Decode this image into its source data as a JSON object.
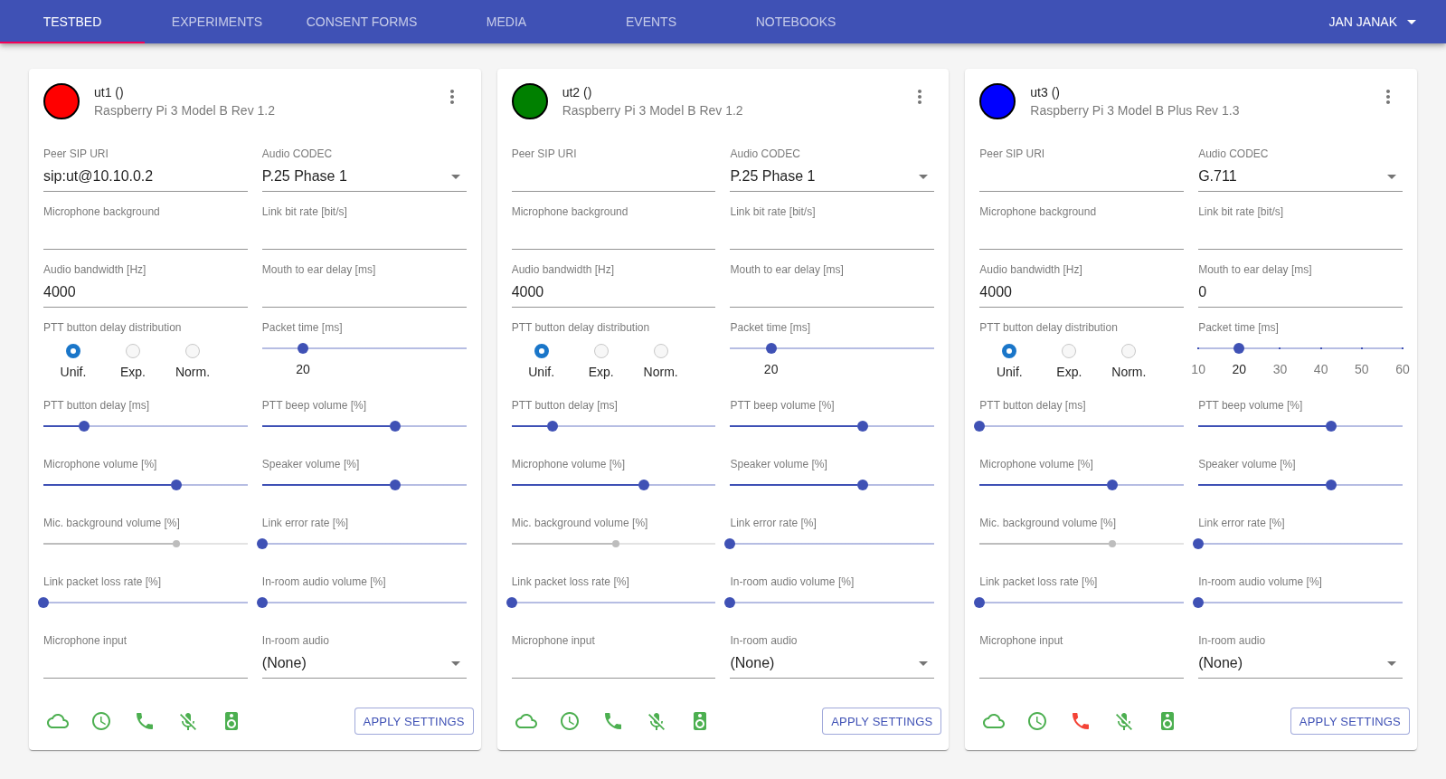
{
  "nav": {
    "tabs": [
      {
        "label": "TESTBED",
        "selected": true
      },
      {
        "label": "EXPERIMENTS",
        "selected": false
      },
      {
        "label": "CONSENT FORMS",
        "selected": false
      },
      {
        "label": "MEDIA",
        "selected": false
      },
      {
        "label": "EVENTS",
        "selected": false
      },
      {
        "label": "NOTEBOOKS",
        "selected": false
      }
    ],
    "user_menu": {
      "label": "JAN JANAK"
    }
  },
  "devices": [
    {
      "name": "ut1 ()",
      "model": "Raspberry Pi 3 Model B Rev 1.2",
      "color": "#ff0000",
      "fields": [
        {
          "kind": "text",
          "label": "Peer SIP URI",
          "value": "sip:ut@10.10.0.2"
        },
        {
          "kind": "select",
          "label": "Audio CODEC",
          "value": "P.25 Phase 1"
        },
        {
          "kind": "text",
          "label": "Microphone background"
        },
        {
          "kind": "text",
          "label": "Link bit rate [bit/s]"
        },
        {
          "kind": "text",
          "label": "Audio bandwidth [Hz]",
          "value": "4000"
        },
        {
          "kind": "text",
          "label": "Mouth to ear delay [ms]"
        },
        {
          "kind": "radio",
          "label": "PTT button delay distribution",
          "options": [
            {
              "label": "Unif.",
              "selected": true
            },
            {
              "label": "Exp.",
              "selected": false
            },
            {
              "label": "Norm.",
              "selected": false
            }
          ]
        },
        {
          "kind": "stepped_slider",
          "label": "Packet time [ms]",
          "level": 0.2,
          "marks": [
            {
              "label": "20",
              "selected": true
            }
          ]
        },
        {
          "kind": "slider",
          "label": "PTT button delay [ms]",
          "level": 0.2,
          "disabled": false
        },
        {
          "kind": "slider",
          "label": "PTT beep volume [%]",
          "level": 0.65,
          "disabled": false
        },
        {
          "kind": "slider",
          "label": "Microphone volume [%]",
          "level": 0.65,
          "disabled": false
        },
        {
          "kind": "slider",
          "label": "Speaker volume [%]",
          "level": 0.65,
          "disabled": false
        },
        {
          "kind": "slider",
          "label": "Mic. background volume [%]",
          "level": 0.65,
          "disabled": true
        },
        {
          "kind": "slider",
          "label": "Link error rate [%]",
          "level": 0,
          "disabled": false
        },
        {
          "kind": "slider",
          "label": "Link packet loss rate [%]",
          "level": 0,
          "disabled": false
        },
        {
          "kind": "slider",
          "label": "In-room audio volume [%]",
          "level": 0,
          "disabled": false
        },
        {
          "kind": "text",
          "label": "Microphone input"
        },
        {
          "kind": "select",
          "label": "In-room audio",
          "value": "(None)"
        }
      ],
      "status_icons": [
        {
          "kind": "cloud",
          "color": "#4caf50"
        },
        {
          "kind": "clock",
          "color": "#4caf50"
        },
        {
          "kind": "phone",
          "color": "#4caf50"
        },
        {
          "kind": "mic_off",
          "color": "#4caf50"
        },
        {
          "kind": "speaker",
          "color": "#4caf50"
        }
      ],
      "apply_button": "APPLY SETTINGS"
    },
    {
      "name": "ut2 ()",
      "model": "Raspberry Pi 3 Model B Rev 1.2",
      "color": "#008000",
      "fields": [
        {
          "kind": "text",
          "label": "Peer SIP URI"
        },
        {
          "kind": "select",
          "label": "Audio CODEC",
          "value": "P.25 Phase 1"
        },
        {
          "kind": "text",
          "label": "Microphone background"
        },
        {
          "kind": "text",
          "label": "Link bit rate [bit/s]"
        },
        {
          "kind": "text",
          "label": "Audio bandwidth [Hz]",
          "value": "4000"
        },
        {
          "kind": "text",
          "label": "Mouth to ear delay [ms]"
        },
        {
          "kind": "radio",
          "label": "PTT button delay distribution",
          "options": [
            {
              "label": "Unif.",
              "selected": true
            },
            {
              "label": "Exp.",
              "selected": false
            },
            {
              "label": "Norm.",
              "selected": false
            }
          ]
        },
        {
          "kind": "stepped_slider",
          "label": "Packet time [ms]",
          "level": 0.2,
          "marks": [
            {
              "label": "20",
              "selected": true
            }
          ]
        },
        {
          "kind": "slider",
          "label": "PTT button delay [ms]",
          "level": 0.2,
          "disabled": false
        },
        {
          "kind": "slider",
          "label": "PTT beep volume [%]",
          "level": 0.65,
          "disabled": false
        },
        {
          "kind": "slider",
          "label": "Microphone volume [%]",
          "level": 0.65,
          "disabled": false
        },
        {
          "kind": "slider",
          "label": "Speaker volume [%]",
          "level": 0.65,
          "disabled": false
        },
        {
          "kind": "slider",
          "label": "Mic. background volume [%]",
          "level": 0.51,
          "disabled": true
        },
        {
          "kind": "slider",
          "label": "Link error rate [%]",
          "level": 0,
          "disabled": false
        },
        {
          "kind": "slider",
          "label": "Link packet loss rate [%]",
          "level": 0,
          "disabled": false
        },
        {
          "kind": "slider",
          "label": "In-room audio volume [%]",
          "level": 0,
          "disabled": false
        },
        {
          "kind": "text",
          "label": "Microphone input"
        },
        {
          "kind": "select",
          "label": "In-room audio",
          "value": "(None)"
        }
      ],
      "status_icons": [
        {
          "kind": "cloud",
          "color": "#4caf50"
        },
        {
          "kind": "clock",
          "color": "#4caf50"
        },
        {
          "kind": "phone",
          "color": "#4caf50"
        },
        {
          "kind": "mic_off",
          "color": "#4caf50"
        },
        {
          "kind": "speaker",
          "color": "#4caf50"
        }
      ],
      "apply_button": "APPLY SETTINGS"
    },
    {
      "name": "ut3 ()",
      "model": "Raspberry Pi 3 Model B Plus Rev 1.3",
      "color": "#0000ff",
      "fields": [
        {
          "kind": "text",
          "label": "Peer SIP URI"
        },
        {
          "kind": "select",
          "label": "Audio CODEC",
          "value": "G.711"
        },
        {
          "kind": "text",
          "label": "Microphone background"
        },
        {
          "kind": "text",
          "label": "Link bit rate [bit/s]"
        },
        {
          "kind": "text",
          "label": "Audio bandwidth [Hz]",
          "value": "4000"
        },
        {
          "kind": "text",
          "label": "Mouth to ear delay [ms]",
          "value": "0"
        },
        {
          "kind": "radio",
          "label": "PTT button delay distribution",
          "options": [
            {
              "label": "Unif.",
              "selected": true
            },
            {
              "label": "Exp.",
              "selected": false
            },
            {
              "label": "Norm.",
              "selected": false
            }
          ]
        },
        {
          "kind": "stepped_slider",
          "label": "Packet time [ms]",
          "level": 0.2,
          "marks": [
            {
              "label": "10",
              "selected": false
            },
            {
              "label": "20",
              "selected": true
            },
            {
              "label": "30",
              "selected": false
            },
            {
              "label": "40",
              "selected": false
            },
            {
              "label": "50",
              "selected": false
            },
            {
              "label": "60",
              "selected": false
            }
          ]
        },
        {
          "kind": "slider",
          "label": "PTT button delay [ms]",
          "level": 0,
          "disabled": false
        },
        {
          "kind": "slider",
          "label": "PTT beep volume [%]",
          "level": 0.65,
          "disabled": false
        },
        {
          "kind": "slider",
          "label": "Microphone volume [%]",
          "level": 0.65,
          "disabled": false
        },
        {
          "kind": "slider",
          "label": "Speaker volume [%]",
          "level": 0.65,
          "disabled": false
        },
        {
          "kind": "slider",
          "label": "Mic. background volume [%]",
          "level": 0.65,
          "disabled": true
        },
        {
          "kind": "slider",
          "label": "Link error rate [%]",
          "level": 0,
          "disabled": false
        },
        {
          "kind": "slider",
          "label": "Link packet loss rate [%]",
          "level": 0,
          "disabled": false
        },
        {
          "kind": "slider",
          "label": "In-room audio volume [%]",
          "level": 0,
          "disabled": false
        },
        {
          "kind": "text",
          "label": "Microphone input"
        },
        {
          "kind": "select",
          "label": "In-room audio",
          "value": "(None)"
        }
      ],
      "status_icons": [
        {
          "kind": "cloud",
          "color": "#4caf50"
        },
        {
          "kind": "clock",
          "color": "#4caf50"
        },
        {
          "kind": "phone",
          "color": "#f44336"
        },
        {
          "kind": "mic_off",
          "color": "#4caf50"
        },
        {
          "kind": "speaker",
          "color": "#4caf50"
        }
      ],
      "apply_button": "APPLY SETTINGS"
    }
  ]
}
